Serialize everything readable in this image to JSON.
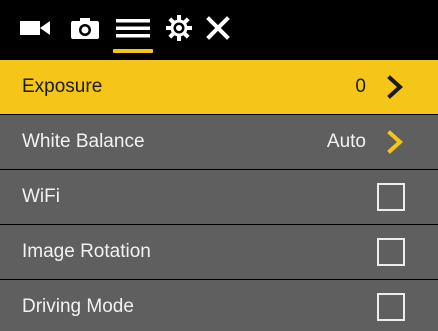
{
  "toolbar": {
    "icons": [
      "video-camera-icon",
      "photo-camera-icon",
      "menu-list-icon",
      "settings-gear-icon",
      "close-icon"
    ],
    "active_tab": "menu-list-icon"
  },
  "menu": {
    "items": [
      {
        "label": "Exposure",
        "value": "0",
        "control": "chevron",
        "selected": true
      },
      {
        "label": "White Balance",
        "value": "Auto",
        "control": "chevron",
        "selected": false
      },
      {
        "label": "WiFi",
        "control": "checkbox",
        "checked": false,
        "selected": false
      },
      {
        "label": "Image Rotation",
        "control": "checkbox",
        "checked": false,
        "selected": false
      },
      {
        "label": "Driving Mode",
        "control": "checkbox",
        "checked": false,
        "selected": false
      }
    ]
  },
  "colors": {
    "accent": "#f5c518",
    "row_background": "#5f5f5f",
    "background": "#000000",
    "text": "#f2f2f2",
    "selected_text": "#1a1a1a"
  }
}
